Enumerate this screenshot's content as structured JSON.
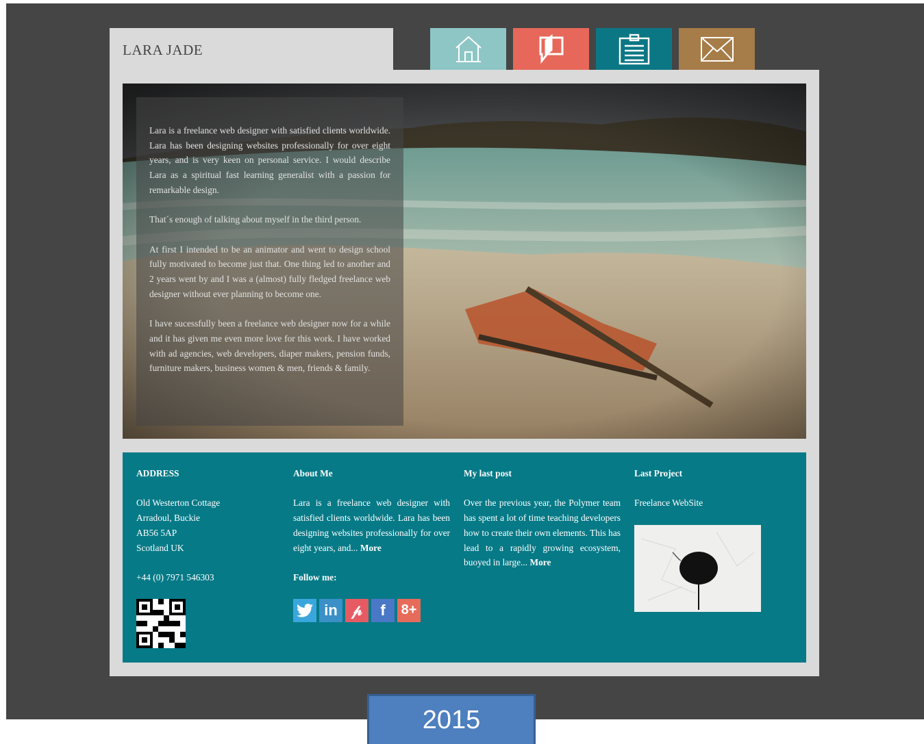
{
  "site": {
    "title": "LARA JADE"
  },
  "nav": [
    {
      "icon": "home-icon",
      "color": "#8ec6c6"
    },
    {
      "icon": "chat-pen-icon",
      "color": "#e7685a"
    },
    {
      "icon": "clipboard-icon",
      "color": "#0c7784"
    },
    {
      "icon": "mail-icon",
      "color": "#a67c48"
    }
  ],
  "hero": {
    "paragraphs": [
      "Lara is a freelance web designer with satisfied clients worldwide. Lara has been designing websites professionally for over eight years, and is very keen on personal service. I would describe Lara as a spiritual fast learning generalist with a passion for remarkable design.",
      "That´s enough of talking about myself in the third person.",
      "At first I intended to be an animator and went to design school fully motivated to become just that. One thing led to another and 2 years went by and I was a (almost) fully fledged freelance web designer without ever planning to become one.",
      "I have sucessfully been a freelance web designer now for a while and it has given me even more love for this work. I have worked with ad agencies, web developers, diaper makers, pension funds, furniture makers, business women & men, friends & family."
    ]
  },
  "footer": {
    "address": {
      "heading": "ADDRESS",
      "lines": [
        "Old Westerton Cottage",
        "Arradoul, Buckie",
        "AB56 5AP",
        "Scotland UK"
      ],
      "phone": "+44 (0) 7971 546303"
    },
    "about": {
      "heading": "About Me",
      "text": "Lara is a freelance web designer with satisfied clients worldwide. Lara has been designing websites professionally for over eight years, and...",
      "more": "More",
      "follow_heading": "Follow me:",
      "social": [
        {
          "icon": "twitter-icon",
          "glyph": "🐦",
          "color": "#3aa6dd"
        },
        {
          "icon": "linkedin-icon",
          "glyph": "in",
          "color": "#3a90c7"
        },
        {
          "icon": "pinterest-icon",
          "glyph": "𝓅",
          "color": "#e65b63"
        },
        {
          "icon": "facebook-icon",
          "glyph": "f",
          "color": "#4a78c6"
        },
        {
          "icon": "googleplus-icon",
          "glyph": "8+",
          "color": "#e76b5b"
        }
      ]
    },
    "post": {
      "heading": "My last post",
      "text": "Over the previous year, the Polymer team has spent a lot of time teaching developers how to create their own elements. This has lead to a rapidly growing ecosystem, buoyed in large...",
      "more": "More"
    },
    "project": {
      "heading": "Last Project",
      "name": "Freelance WebSite"
    }
  },
  "year_label": "2015"
}
